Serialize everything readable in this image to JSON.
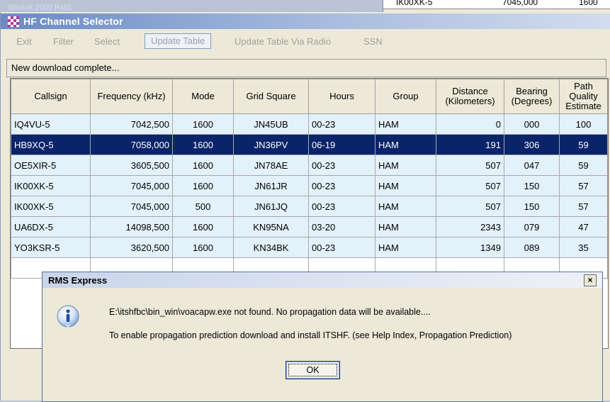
{
  "background_window": {
    "cells": [
      "IK00XK-5",
      "7045,000",
      "1600"
    ]
  },
  "window": {
    "title": "HF Channel Selector",
    "faded_title": "Winlink 2000 RMS"
  },
  "menu": {
    "items": [
      "Exit",
      "Filter",
      "Select",
      "Update Table",
      "Update Table Via Radio",
      "SSN"
    ]
  },
  "status": {
    "text": "New download complete..."
  },
  "table": {
    "headers": [
      "Callsign",
      "Frequency (kHz)",
      "Mode",
      "Grid Square",
      "Hours",
      "Group",
      "Distance (Kilometers)",
      "Bearing (Degrees)",
      "Path Quality Estimate"
    ],
    "rows": [
      [
        "IQ4VU-5",
        "7042,500",
        "1600",
        "JN45UB",
        "00-23",
        "HAM",
        "0",
        "000",
        "100"
      ],
      [
        "HB9XQ-5",
        "7058,000",
        "1600",
        "JN36PV",
        "06-19",
        "HAM",
        "191",
        "306",
        "59"
      ],
      [
        "OE5XIR-5",
        "3605,500",
        "1600",
        "JN78AE",
        "00-23",
        "HAM",
        "507",
        "047",
        "59"
      ],
      [
        "IK00XK-5",
        "7045,000",
        "1600",
        "JN61JR",
        "00-23",
        "HAM",
        "507",
        "150",
        "57"
      ],
      [
        "IK00XK-5",
        "7045,000",
        "500",
        "JN61JQ",
        "00-23",
        "HAM",
        "507",
        "150",
        "57"
      ],
      [
        "UA6DX-5",
        "14098,500",
        "1600",
        "KN95NA",
        "03-20",
        "HAM",
        "2343",
        "079",
        "47"
      ],
      [
        "YO3KSR-5",
        "3620,500",
        "1600",
        "KN34BK",
        "00-23",
        "HAM",
        "1349",
        "089",
        "35"
      ]
    ],
    "selected_row": 1
  },
  "dialog": {
    "title": "RMS Express",
    "message_line1": "E:\\itshfbc\\bin_win\\voacapw.exe not found. No propagation data will be available....",
    "message_line2": "To enable propagation prediction download and install ITSHF. (see Help Index, Propagation Prediction)",
    "ok_label": "OK",
    "close_glyph": "×"
  },
  "colors": {
    "selection": "#0a246a",
    "row_background": "#e3f1fb",
    "titlebar": "#6b8ac4"
  }
}
